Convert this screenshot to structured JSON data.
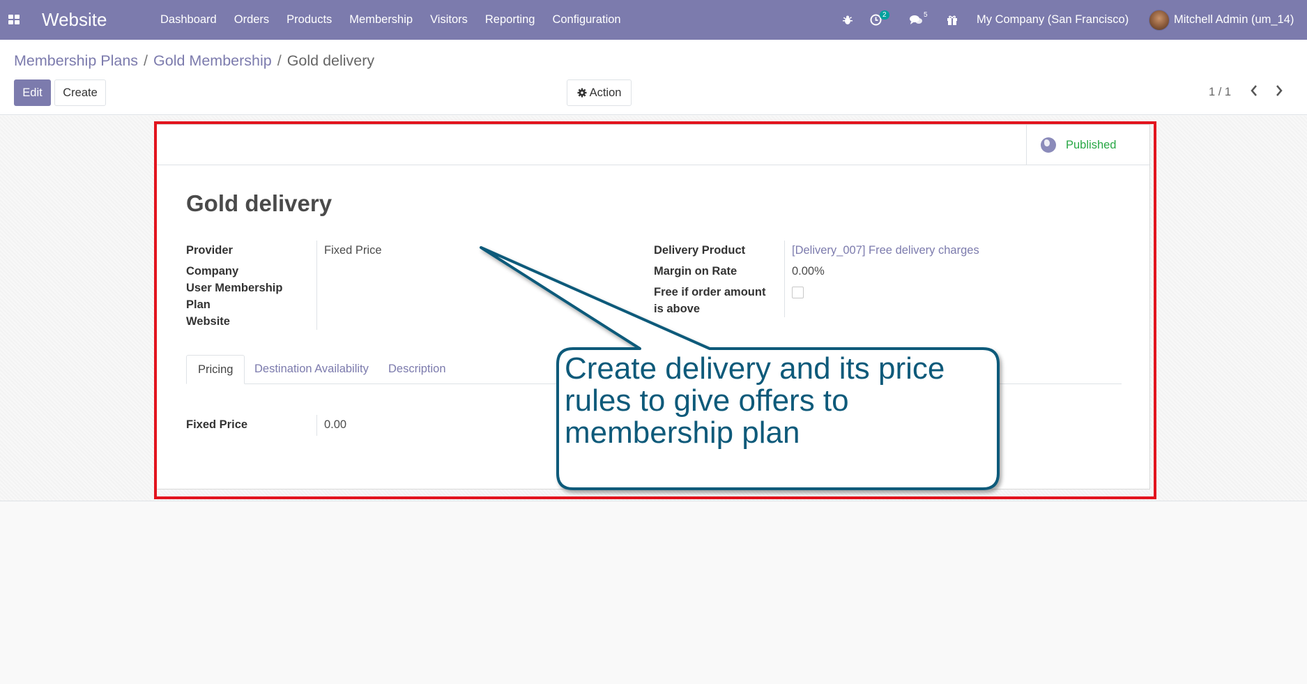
{
  "navbar": {
    "app_name": "Website",
    "menu": [
      "Dashboard",
      "Orders",
      "Products",
      "Membership",
      "Visitors",
      "Reporting",
      "Configuration"
    ],
    "activity_count": "2",
    "messages_count": "5",
    "company": "My Company (San Francisco)",
    "user": "Mitchell Admin (um_14)"
  },
  "breadcrumb": {
    "item1": "Membership Plans",
    "item2": "Gold Membership",
    "current": "Gold delivery",
    "separator": "/"
  },
  "toolbar": {
    "edit_label": "Edit",
    "create_label": "Create",
    "action_label": "Action",
    "pager": "1 / 1"
  },
  "status": {
    "published_label": "Published"
  },
  "form": {
    "title": "Gold delivery",
    "left_fields": {
      "provider_label": "Provider",
      "provider_value": "Fixed Price",
      "company_label": "Company",
      "membership_label_line1": "User Membership",
      "membership_label_line2": "Plan",
      "website_label": "Website"
    },
    "right_fields": {
      "delivery_product_label": "Delivery Product",
      "delivery_product_value": "[Delivery_007] Free delivery charges",
      "margin_label": "Margin on Rate",
      "margin_value": "0.00%",
      "free_label_line1": "Free if order amount",
      "free_label_line2": "is above"
    },
    "tabs": [
      "Pricing",
      "Destination Availability",
      "Description"
    ],
    "pricing": {
      "fixed_price_label": "Fixed Price",
      "fixed_price_value": "0.00"
    }
  },
  "callout": {
    "line1": "Create delivery and its price",
    "line2": "rules to give offers to",
    "line3": "membership plan"
  },
  "colors": {
    "brand": "#7c7bad",
    "published": "#28a745",
    "highlight": "#e2141e",
    "callout_stroke": "#0e5a7a"
  }
}
